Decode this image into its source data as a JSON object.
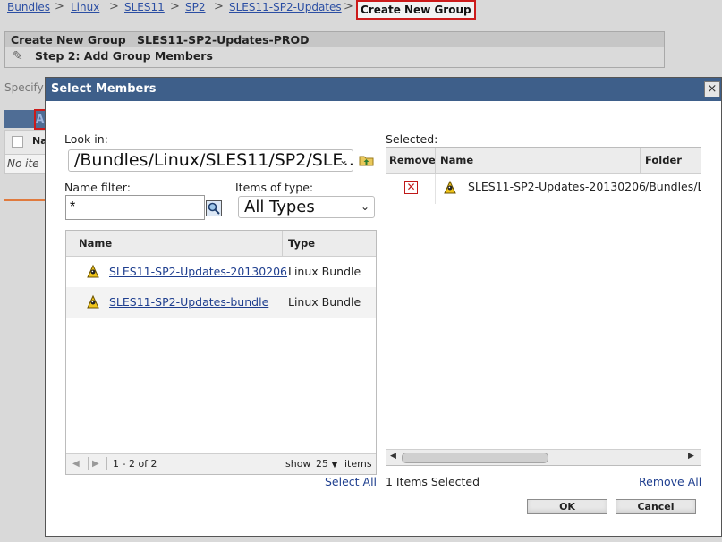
{
  "breadcrumb": {
    "items": [
      "Bundles",
      "Linux",
      "SLES11",
      "SP2",
      "SLES11-SP2-Updates"
    ],
    "separator": ">",
    "current": "Create New Group"
  },
  "group_header": {
    "title": "Create New Group",
    "name": "SLES11-SP2-Updates-PROD",
    "step": "Step 2: Add Group Members"
  },
  "background": {
    "specify_text": "Specify",
    "table_head_letter": "A",
    "col_name_fragment": "Na",
    "no_items_fragment": "No ite"
  },
  "dialog": {
    "title": "Select Members",
    "close_symbol": "×",
    "look_in_label": "Look in:",
    "look_in_value": "/Bundles/Linux/SLES11/SP2/SLE…",
    "name_filter_label": "Name filter:",
    "name_filter_value": "*",
    "items_of_type_label": "Items of type:",
    "items_of_type_value": "All Types",
    "browse_table": {
      "columns": [
        "Name",
        "Type"
      ],
      "rows": [
        {
          "name": "SLES11-SP2-Updates-20130206",
          "type": "Linux Bundle"
        },
        {
          "name": "SLES11-SP2-Updates-bundle",
          "type": "Linux Bundle"
        }
      ],
      "pager": {
        "range": "1 - 2 of 2",
        "show_label": "show",
        "page_size": "25",
        "items_label": "items"
      }
    },
    "select_all": "Select All",
    "selected_label": "Selected:",
    "selected_table": {
      "columns": [
        "Remove",
        "Name",
        "Folder"
      ],
      "rows": [
        {
          "name": "SLES11-SP2-Updates-20130206",
          "folder": "/Bundles/L"
        }
      ]
    },
    "items_selected": "1 Items Selected",
    "remove_all": "Remove All",
    "ok": "OK",
    "cancel": "Cancel"
  }
}
